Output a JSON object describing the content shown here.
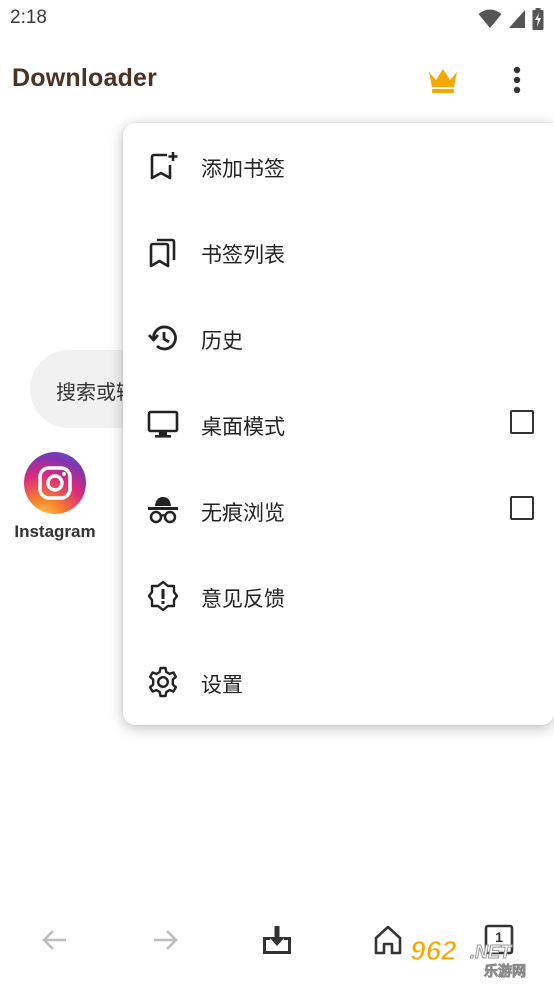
{
  "status": {
    "time": "2:18",
    "icons": [
      "wifi-icon",
      "signal-icon",
      "battery-icon"
    ]
  },
  "appbar": {
    "title": "Downloader",
    "premium_icon": "crown-icon",
    "more_icon": "more-vert-icon",
    "accent_color": "#f7a800"
  },
  "search": {
    "placeholder": "搜索或输"
  },
  "shortcuts": [
    {
      "label": "Instagram",
      "icon": "instagram-icon"
    }
  ],
  "menu": {
    "items": [
      {
        "label": "添加书签",
        "icon": "bookmark-add-icon",
        "checkbox": false
      },
      {
        "label": "书签列表",
        "icon": "bookmarks-icon",
        "checkbox": false
      },
      {
        "label": "历史",
        "icon": "history-icon",
        "checkbox": false
      },
      {
        "label": "桌面模式",
        "icon": "desktop-icon",
        "checkbox": true,
        "checked": false
      },
      {
        "label": "无痕浏览",
        "icon": "incognito-icon",
        "checkbox": true,
        "checked": false
      },
      {
        "label": "意见反馈",
        "icon": "feedback-icon",
        "checkbox": false
      },
      {
        "label": "设置",
        "icon": "settings-icon",
        "checkbox": false
      }
    ]
  },
  "bottom_nav": {
    "icons": [
      "back-arrow-icon",
      "forward-arrow-icon",
      "download-icon",
      "home-icon",
      "tabs-icon"
    ],
    "tab_count": "1"
  },
  "watermark": {
    "text_big": "962.NET",
    "text_small": "乐游网"
  }
}
